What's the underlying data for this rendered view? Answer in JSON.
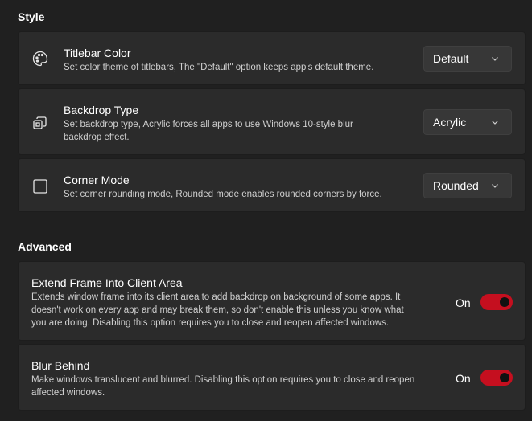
{
  "style_section": {
    "title": "Style",
    "items": [
      {
        "icon": "palette-icon",
        "title": "Titlebar Color",
        "description": "Set color theme of titlebars, The \"Default\" option keeps app's default theme.",
        "value": "Default"
      },
      {
        "icon": "backdrop-icon",
        "title": "Backdrop Type",
        "description_line1": "Set backdrop type, Acrylic forces all apps to use Windows 10-style blur",
        "description_line2": "backdrop effect.",
        "value": "Acrylic"
      },
      {
        "icon": "square-icon",
        "title": "Corner Mode",
        "description": "Set corner rounding mode, Rounded mode enables rounded corners by force.",
        "value": "Rounded"
      }
    ]
  },
  "advanced_section": {
    "title": "Advanced",
    "items": [
      {
        "title": "Extend Frame Into Client Area",
        "description_line1": "Extends window frame into its client area to add backdrop on background of some apps. It",
        "description_line2": "doesn't work on every app and may break them, so don't enable this unless you know what",
        "description_line3": "you are doing. Disabling this option requires you to close and reopen affected windows.",
        "state_label": "On",
        "enabled": true
      },
      {
        "title": "Blur Behind",
        "description_line1": "Make windows translucent and blurred. Disabling this option requires you to close and reopen",
        "description_line2": "affected windows.",
        "state_label": "On",
        "enabled": true
      }
    ]
  },
  "colors": {
    "background": "#202020",
    "card": "#2b2b2b",
    "toggle_on": "#c50f1f"
  }
}
